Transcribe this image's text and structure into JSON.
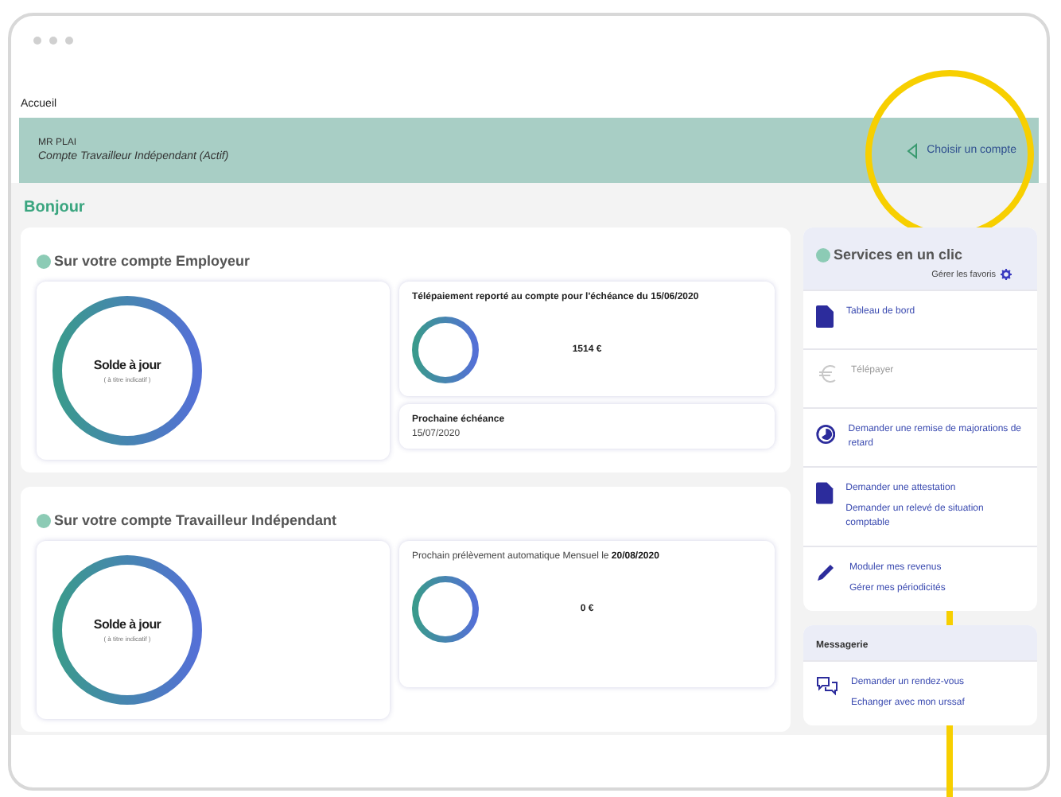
{
  "breadcrumb": "Accueil",
  "account_banner": {
    "name": "MR PLAI",
    "account": "Compte Travailleur Indépendant (Actif)",
    "action": "Choisir un compte"
  },
  "greeting": "Bonjour",
  "accounts": [
    {
      "title": "Sur votre compte Employeur",
      "balance": {
        "label": "Solde à jour",
        "note": "( à titre indicatif )"
      },
      "panels": [
        {
          "kind": "amount",
          "label": "Télépaiement reporté au compte pour l'échéance du 15/06/2020",
          "amount": "1514 €"
        },
        {
          "kind": "date",
          "label": "Prochaine échéance",
          "value": "15/07/2020"
        }
      ]
    },
    {
      "title": "Sur votre compte Travailleur Indépendant",
      "balance": {
        "label": "Solde à jour",
        "note": "( à titre indicatif )"
      },
      "panels": [
        {
          "kind": "amount",
          "label": "Prochain prélèvement automatique Mensuel le **20/08/2020**",
          "amount": "0 €"
        }
      ]
    }
  ],
  "services": {
    "title": "Services en un clic",
    "manage": "Gérer les favoris",
    "items": [
      {
        "kind": "document",
        "links": [
          "Tableau de bord"
        ],
        "disabled": false
      },
      {
        "kind": "euro",
        "links": [
          "Télépayer"
        ],
        "disabled": true
      },
      {
        "kind": "clock",
        "links": [
          "Demander une remise de majorations de retard"
        ],
        "disabled": false
      },
      {
        "kind": "document",
        "links": [
          "Demander une attestation",
          "Demander un relevé de situation comptable"
        ],
        "disabled": false
      },
      {
        "kind": "pencil",
        "links": [
          "Moduler mes revenus",
          "Gérer mes périodicités"
        ],
        "disabled": false
      }
    ]
  },
  "messaging": {
    "title": "Messagerie",
    "items": [
      {
        "kind": "chat",
        "links": [
          "Demander un rendez-vous",
          "Echanger avec mon urssaf"
        ],
        "disabled": false
      }
    ]
  }
}
